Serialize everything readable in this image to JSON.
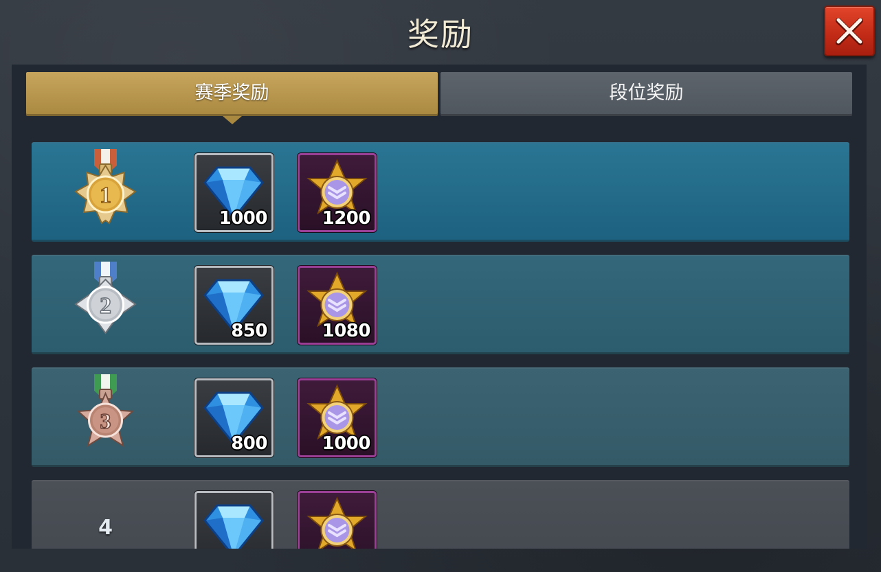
{
  "title": "奖励",
  "close_icon": "close-x-icon",
  "tabs": {
    "season": "赛季奖励",
    "rank": "段位奖励",
    "active": "season"
  },
  "colors": {
    "active_tab": "#b8974e",
    "inactive_tab": "#575e66",
    "close_button": "#d2361f",
    "gem_frame": "#b9bcc1",
    "medal_frame": "#9a3f95"
  },
  "rewards": [
    {
      "rank": "1",
      "rank_icon": "gold-medal-1-icon",
      "gem_icon": "blue-diamond-icon",
      "gem_qty": "1000",
      "medal_icon": "star-badge-icon",
      "medal_qty": "1200"
    },
    {
      "rank": "2",
      "rank_icon": "silver-medal-2-icon",
      "gem_icon": "blue-diamond-icon",
      "gem_qty": "850",
      "medal_icon": "star-badge-icon",
      "medal_qty": "1080"
    },
    {
      "rank": "3",
      "rank_icon": "bronze-medal-3-icon",
      "gem_icon": "blue-diamond-icon",
      "gem_qty": "800",
      "medal_icon": "star-badge-icon",
      "medal_qty": "1000"
    },
    {
      "rank": "4",
      "rank_icon": "",
      "gem_icon": "blue-diamond-icon",
      "gem_qty": "",
      "medal_icon": "star-badge-icon",
      "medal_qty": ""
    }
  ]
}
